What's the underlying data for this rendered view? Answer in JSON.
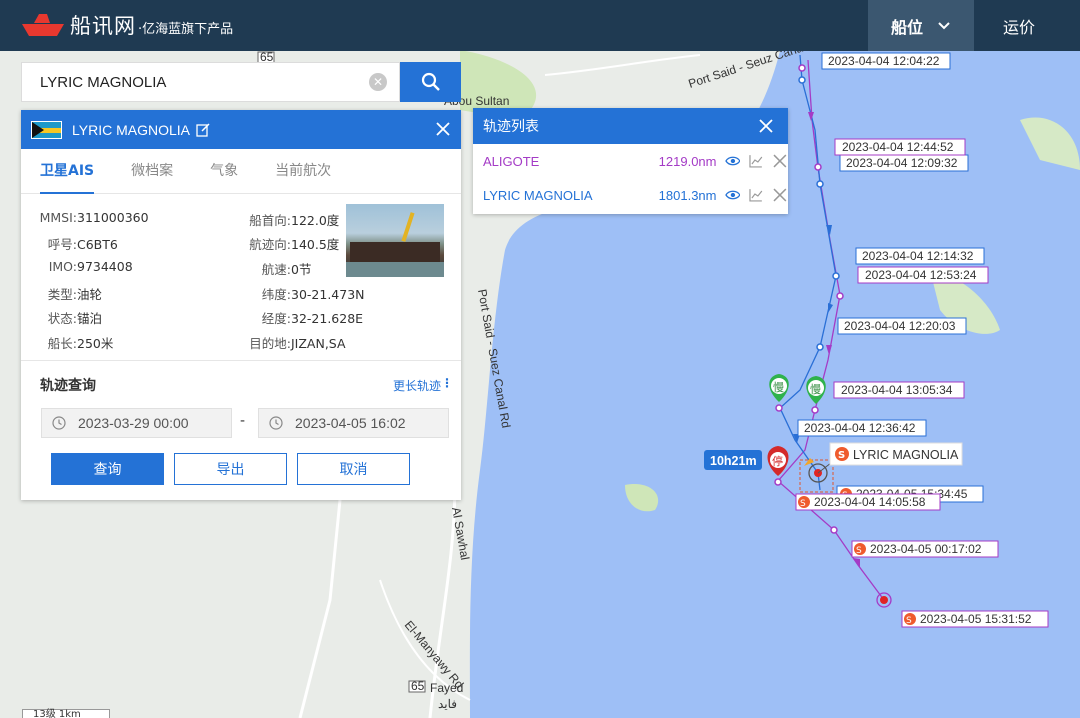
{
  "header": {
    "brand": "船讯网",
    "slogan": "·亿海蓝旗下产品",
    "nav": [
      {
        "label": "船位",
        "active": true
      },
      {
        "label": "运价",
        "active": false
      }
    ]
  },
  "search": {
    "value": "LYRIC MAGNOLIA"
  },
  "ship": {
    "name": "LYRIC MAGNOLIA",
    "tabs": [
      "卫星AIS",
      "微档案",
      "气象",
      "当前航次"
    ],
    "left": [
      {
        "label": "MMSI:",
        "value": "311000360"
      },
      {
        "label": "呼号:",
        "value": "C6BT6"
      },
      {
        "label": "IMO:",
        "value": "9734408"
      },
      {
        "label": "类型:",
        "value": "油轮"
      },
      {
        "label": "状态:",
        "value": "锚泊"
      },
      {
        "label": "船长:",
        "value": "250米"
      }
    ],
    "right": [
      {
        "label": "船首向:",
        "value": "122.0度"
      },
      {
        "label": "航迹向:",
        "value": "140.5度"
      },
      {
        "label": "航速:",
        "value": "0节"
      },
      {
        "label": "纬度:",
        "value": "30-21.473N"
      },
      {
        "label": "经度:",
        "value": "32-21.628E"
      },
      {
        "label": "目的地:",
        "value": "JIZAN,SA"
      }
    ]
  },
  "track": {
    "title": "轨迹查询",
    "more": "更长轨迹",
    "start": "2023-03-29 00:00",
    "separator": "-",
    "end": "2023-04-05 16:02",
    "buttons": {
      "query": "查询",
      "export": "导出",
      "cancel": "取消"
    }
  },
  "track_list": {
    "title": "轨迹列表",
    "items": [
      {
        "name": "ALIGOTE",
        "distance": "1219.0nm",
        "color": "#a43bc6"
      },
      {
        "name": "LYRIC MAGNOLIA",
        "distance": "1801.3nm",
        "color": "#2472d6"
      }
    ]
  },
  "map": {
    "place_labels": [
      "Abou Sultan",
      "Fayed",
      "فايد",
      "Port Said - Seuz Canal",
      "Port Said - Suez Canal Rd",
      "Al Sawhal",
      "El-Manyawy Rd",
      "65",
      "65"
    ],
    "blue_track_times": [
      "2023-04-04 12:04:22",
      "2023-04-04 12:09:32",
      "2023-04-04 12:14:32",
      "2023-04-04 12:20:03",
      "2023-04-04 12:36:42",
      "2023-04-05 15:34:45"
    ],
    "purple_track_times": [
      "2023-04-04 12:44:52",
      "2023-04-04 12:53:24",
      "2023-04-04 13:05:34",
      "2023-04-04 14:05:58",
      "2023-04-05 00:17:02",
      "2023-04-05 15:31:52"
    ],
    "ship_label": "LYRIC MAGNOLIA",
    "stop_duration": "10h21m",
    "markers": {
      "slow": "慢",
      "stop": "停",
      "s": "S"
    },
    "scale_text": "13级 1km",
    "colors": {
      "water": "#9ebff6",
      "land": "#e9ece8",
      "blue_track": "#2a6fd6",
      "purple_track": "#a43bc6",
      "header": "#1f3a52",
      "accent": "#2472d6"
    }
  }
}
